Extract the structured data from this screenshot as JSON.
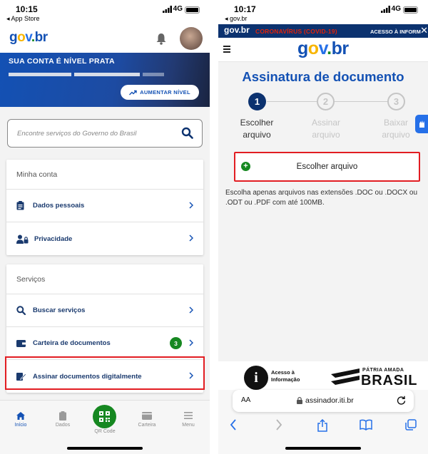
{
  "left": {
    "status": {
      "time": "10:15",
      "back_label": "◂ App Store",
      "network": "4G"
    },
    "header": {
      "logo": {
        "g": "g",
        "o": "o",
        "v": "v",
        "d": ".",
        "b": "br"
      }
    },
    "banner": {
      "title_prefix": "SUA CONTA É NÍVEL",
      "title_level": "PRATA",
      "upgrade_label": "AUMENTAR NÍVEL"
    },
    "search": {
      "placeholder": "Encontre serviços do Governo do Brasil"
    },
    "account": {
      "heading": "Minha conta",
      "items": [
        {
          "label": "Dados pessoais",
          "icon": "clipboard-icon"
        },
        {
          "label": "Privacidade",
          "icon": "user-lock-icon"
        }
      ]
    },
    "services": {
      "heading": "Serviços",
      "items": [
        {
          "label": "Buscar serviços",
          "icon": "search-icon"
        },
        {
          "label": "Carteira de documentos",
          "icon": "wallet-icon",
          "badge": "3"
        },
        {
          "label": "Assinar documentos digitalmente",
          "icon": "sign-document-icon"
        }
      ]
    },
    "tabbar": {
      "home": "Início",
      "data": "Dados",
      "qr": "QR Code",
      "wallet": "Carteira",
      "menu": "Menu"
    }
  },
  "right": {
    "status": {
      "time": "10:17",
      "back_label": "◂ gov.br",
      "network": "4G"
    },
    "covid_bar": {
      "brand": "gov.br",
      "covid": "CORONAVÍRUS (COVID-19)",
      "info": "ACESSO À INFORM",
      "close": "✕"
    },
    "page_title": "Assinatura de documento",
    "steps": [
      {
        "number": "1",
        "line1": "Escolher",
        "line2": "arquivo",
        "active": true
      },
      {
        "number": "2",
        "line1": "Assinar",
        "line2": "arquivo",
        "active": false
      },
      {
        "number": "3",
        "line1": "Baixar",
        "line2": "arquivo",
        "active": false
      }
    ],
    "choose_button": "Escolher arquivo",
    "hint": "Escolha apenas arquivos nas extensões .DOC ou .DOCX ou .ODT ou .PDF com até 100MB.",
    "footer": {
      "access_line1": "Acesso à",
      "access_line2": "Informação",
      "access_symbol": "i",
      "patria": "PÁTRIA AMADA",
      "brasil": "BRASIL"
    },
    "browser": {
      "aa": "AA",
      "url": "assinador.iti.br"
    }
  },
  "colors": {
    "gov_blue": "#1351b4",
    "dark_blue": "#0c326f",
    "green": "#168821",
    "highlight_red": "#e21d22",
    "covid_red": "#e52207"
  }
}
